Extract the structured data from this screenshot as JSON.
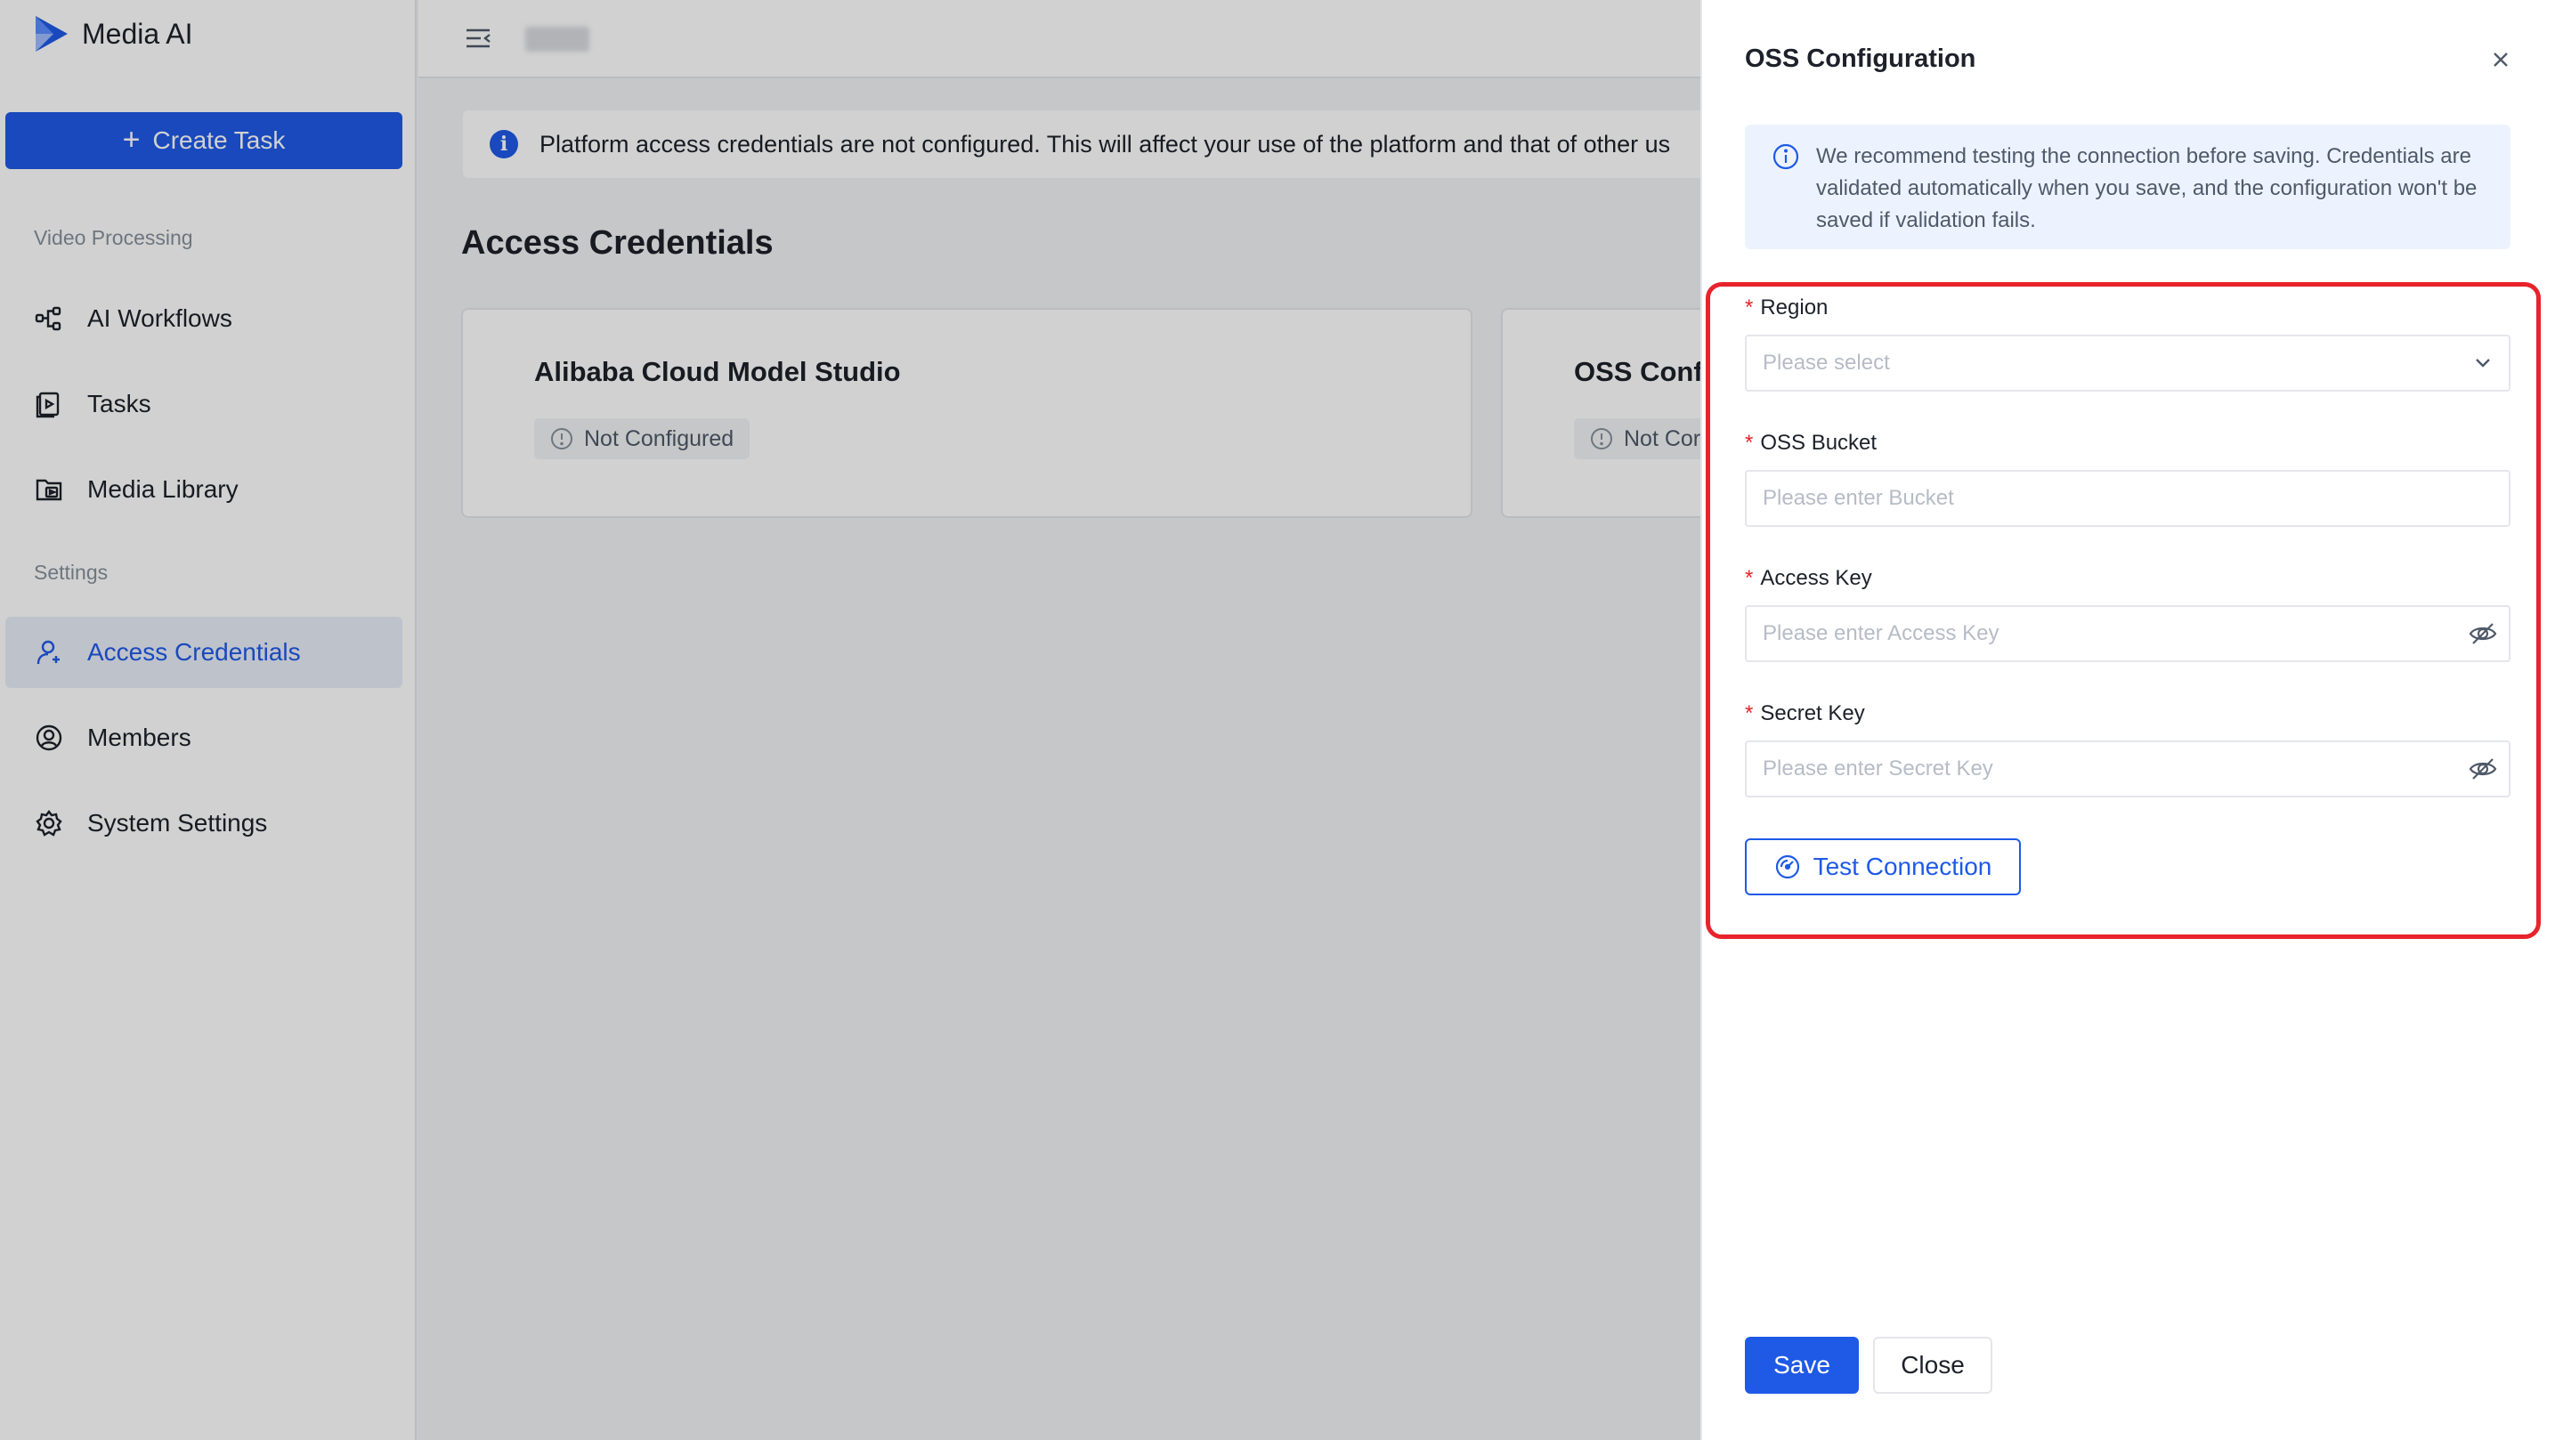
{
  "app": {
    "name": "Media AI",
    "create_task_label": "Create Task"
  },
  "sidebar": {
    "sections": [
      {
        "label": "Video Processing",
        "items": [
          {
            "label": "AI Workflows",
            "icon": "workflow-icon"
          },
          {
            "label": "Tasks",
            "icon": "tasks-icon"
          },
          {
            "label": "Media Library",
            "icon": "media-library-icon"
          }
        ]
      },
      {
        "label": "Settings",
        "items": [
          {
            "label": "Access Credentials",
            "icon": "credentials-icon",
            "active": true
          },
          {
            "label": "Members",
            "icon": "members-icon"
          },
          {
            "label": "System Settings",
            "icon": "gear-icon"
          }
        ]
      }
    ]
  },
  "main": {
    "alert_text": "Platform access credentials are not configured. This will affect your use of the platform and that of other us",
    "page_title": "Access Credentials",
    "cards": [
      {
        "title": "Alibaba Cloud Model Studio",
        "status": "Not Configured"
      },
      {
        "title": "OSS Conf",
        "status": "Not Cor"
      }
    ]
  },
  "drawer": {
    "title": "OSS Configuration",
    "notice": "We recommend testing the connection before saving. Credentials are validated automatically when you save, and the configuration won't be saved if validation fails.",
    "fields": {
      "region": {
        "label": "Region",
        "placeholder": "Please select"
      },
      "bucket": {
        "label": "OSS Bucket",
        "placeholder": "Please enter Bucket"
      },
      "access_key": {
        "label": "Access Key",
        "placeholder": "Please enter Access Key"
      },
      "secret_key": {
        "label": "Secret Key",
        "placeholder": "Please enter Secret Key"
      }
    },
    "required_mark": "*",
    "test_connection_label": "Test Connection",
    "save_label": "Save",
    "close_label": "Close"
  },
  "colors": {
    "primary": "#1f5ae6",
    "highlight_outline": "#e8232b",
    "notice_bg": "#edf3fe"
  }
}
